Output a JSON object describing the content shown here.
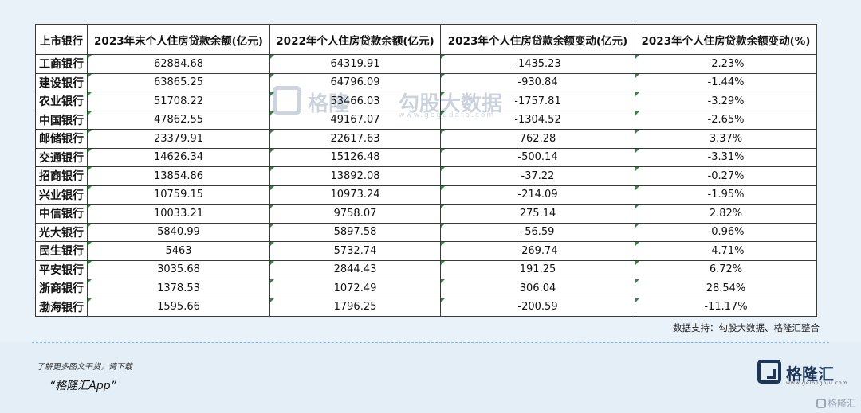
{
  "table": {
    "headers": [
      "上市银行",
      "2023年末个人住房贷款余额(亿元)",
      "2022年个人住房贷款余额(亿元)",
      "2023年个人住房贷款余额变动(亿元)",
      "2023年个人住房贷款余额变动(%)"
    ],
    "rows": [
      [
        "工商银行",
        "62884.68",
        "64319.91",
        "-1435.23",
        "-2.23%"
      ],
      [
        "建设银行",
        "63865.25",
        "64796.09",
        "-930.84",
        "-1.44%"
      ],
      [
        "农业银行",
        "51708.22",
        "53466.03",
        "-1757.81",
        "-3.29%"
      ],
      [
        "中国银行",
        "47862.55",
        "49167.07",
        "-1304.52",
        "-2.65%"
      ],
      [
        "邮储银行",
        "23379.91",
        "22617.63",
        "762.28",
        "3.37%"
      ],
      [
        "交通银行",
        "14626.34",
        "15126.48",
        "-500.14",
        "-3.31%"
      ],
      [
        "招商银行",
        "13854.86",
        "13892.08",
        "-37.22",
        "-0.27%"
      ],
      [
        "兴业银行",
        "10759.15",
        "10973.24",
        "-214.09",
        "-1.95%"
      ],
      [
        "中信银行",
        "10033.21",
        "9758.07",
        "275.14",
        "2.82%"
      ],
      [
        "光大银行",
        "5840.99",
        "5897.58",
        "-56.59",
        "-0.96%"
      ],
      [
        "民生银行",
        "5463",
        "5732.74",
        "-269.74",
        "-4.71%"
      ],
      [
        "平安银行",
        "3035.68",
        "2844.43",
        "191.25",
        "6.72%"
      ],
      [
        "浙商银行",
        "1378.53",
        "1072.49",
        "306.04",
        "28.54%"
      ],
      [
        "渤海银行",
        "1595.66",
        "1796.25",
        "-200.59",
        "-11.17%"
      ]
    ]
  },
  "watermark": {
    "name": "格隆",
    "product": "勾股大数据",
    "url": "www.gogudata.com"
  },
  "source": "数据支持：勾股大数据、格隆汇整合",
  "promo": {
    "line1": "了解更多图文干货，请下载",
    "line2": "“格隆汇App”"
  },
  "brand": {
    "name": "格隆汇",
    "url": "www.gelonghui.com"
  },
  "corner": {
    "text": "格隆汇"
  }
}
